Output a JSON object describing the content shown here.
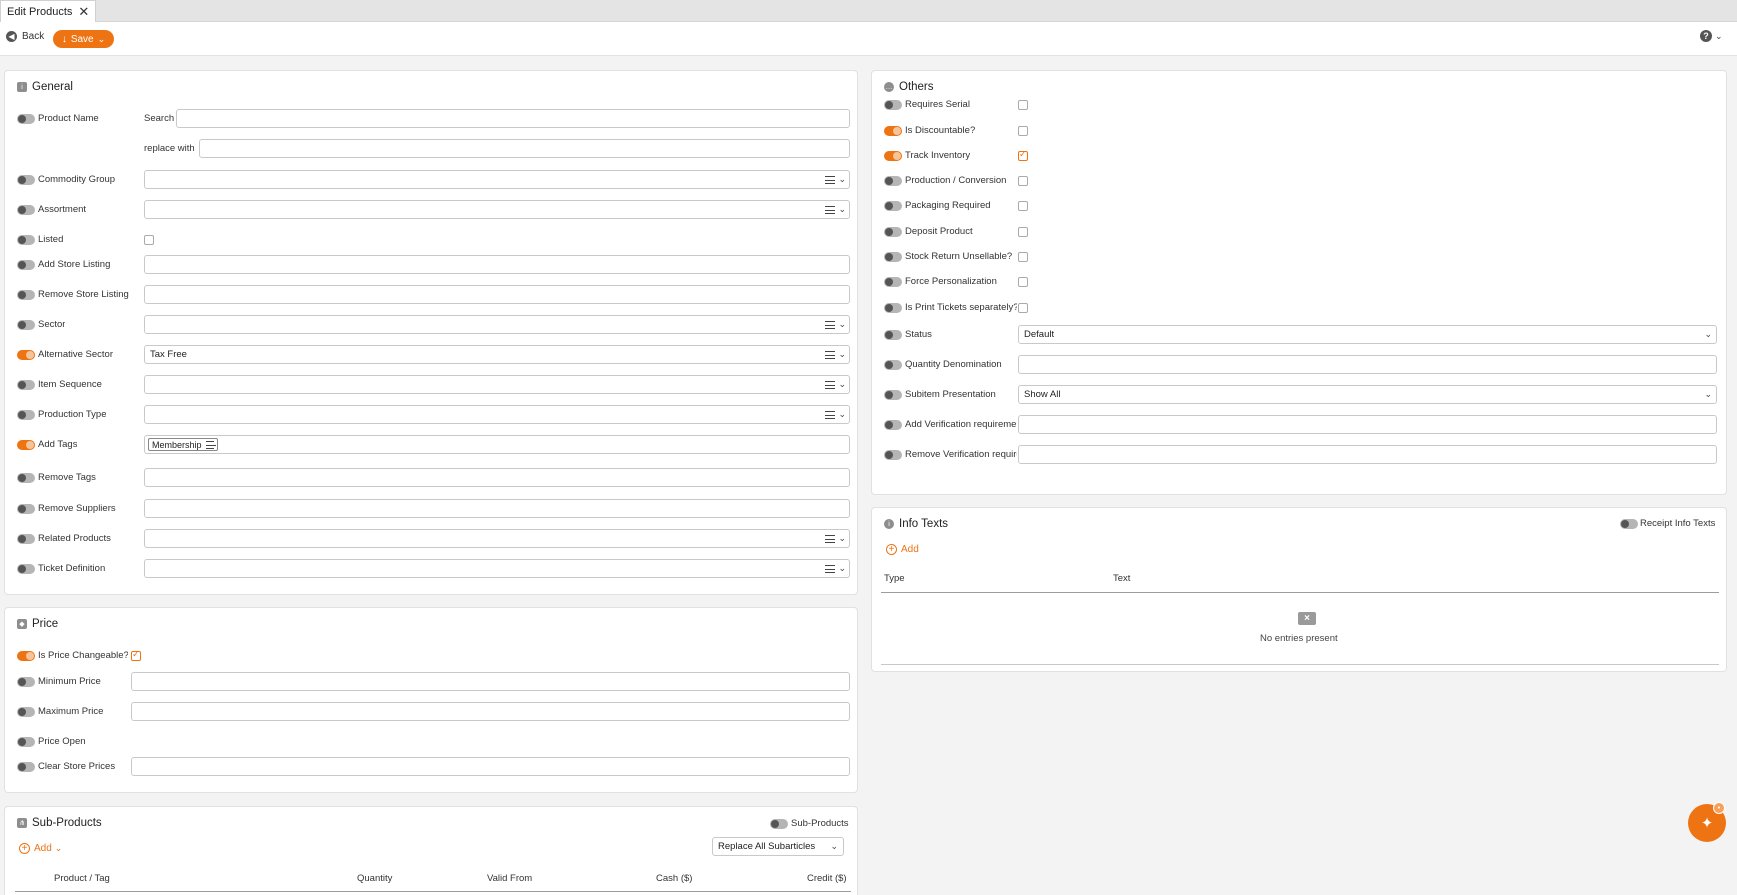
{
  "tab": {
    "title": "Edit Products"
  },
  "toolbar": {
    "back_label": "Back",
    "save_label": "Save"
  },
  "general": {
    "title": "General",
    "product_name": {
      "label": "Product Name",
      "search_label": "Search",
      "replace_label": "replace with",
      "search_value": "",
      "replace_value": ""
    },
    "rows": [
      {
        "label": "Commodity Group",
        "type": "select",
        "value": "",
        "on": false
      },
      {
        "label": "Assortment",
        "type": "select",
        "value": "",
        "on": false
      },
      {
        "label": "Listed",
        "type": "checkbox",
        "checked": false,
        "on": false
      },
      {
        "label": "Add Store Listing",
        "type": "input",
        "value": "",
        "on": false
      },
      {
        "label": "Remove Store Listing",
        "type": "input",
        "value": "",
        "on": false
      },
      {
        "label": "Sector",
        "type": "select",
        "value": "",
        "on": false
      },
      {
        "label": "Alternative Sector",
        "type": "select",
        "value": "Tax Free",
        "on": true
      },
      {
        "label": "Item Sequence",
        "type": "select",
        "value": "",
        "on": false
      },
      {
        "label": "Production Type",
        "type": "select",
        "value": "",
        "on": false
      },
      {
        "label": "Add Tags",
        "type": "tags",
        "value": "Membership",
        "on": true
      },
      {
        "label": "Remove Tags",
        "type": "input",
        "value": "",
        "on": false
      },
      {
        "label": "Remove Suppliers",
        "type": "input",
        "value": "",
        "on": false
      },
      {
        "label": "Related Products",
        "type": "select",
        "value": "",
        "on": false
      },
      {
        "label": "Ticket Definition",
        "type": "select",
        "value": "",
        "on": false
      }
    ]
  },
  "price": {
    "title": "Price",
    "rows": [
      {
        "label": "Is Price Changeable?",
        "type": "checkbox",
        "checked": true,
        "on": true
      },
      {
        "label": "Minimum Price",
        "type": "input",
        "value": "",
        "on": false
      },
      {
        "label": "Maximum Price",
        "type": "input",
        "value": "",
        "on": false
      },
      {
        "label": "Price Open",
        "type": "none",
        "on": false
      },
      {
        "label": "Clear Store Prices",
        "type": "input",
        "value": "",
        "on": false
      }
    ]
  },
  "subproducts": {
    "title": "Sub-Products",
    "toggle_label": "Sub-Products",
    "add_label": "Add",
    "replace_select": "Replace All Subarticles",
    "columns": [
      "Product / Tag",
      "Quantity",
      "Valid From",
      "Cash ($)",
      "Credit ($)"
    ]
  },
  "others": {
    "title": "Others",
    "rows": [
      {
        "label": "Requires Serial",
        "type": "checkbox",
        "checked": false,
        "on": false
      },
      {
        "label": "Is Discountable?",
        "type": "checkbox",
        "checked": false,
        "on": true
      },
      {
        "label": "Track Inventory",
        "type": "checkbox",
        "checked": true,
        "on": true
      },
      {
        "label": "Production / Conversion",
        "type": "checkbox",
        "checked": false,
        "on": false
      },
      {
        "label": "Packaging Required",
        "type": "checkbox",
        "checked": false,
        "on": false
      },
      {
        "label": "Deposit Product",
        "type": "checkbox",
        "checked": false,
        "on": false
      },
      {
        "label": "Stock Return Unsellable?",
        "type": "checkbox",
        "checked": false,
        "on": false
      },
      {
        "label": "Force Personalization",
        "type": "checkbox",
        "checked": false,
        "on": false
      },
      {
        "label": "Is Print Tickets separately?",
        "type": "checkbox",
        "checked": false,
        "on": false
      },
      {
        "label": "Status",
        "type": "dropdown",
        "value": "Default",
        "on": false
      },
      {
        "label": "Quantity Denomination",
        "type": "input",
        "value": "",
        "on": false
      },
      {
        "label": "Subitem Presentation",
        "type": "dropdown",
        "value": "Show All",
        "on": false
      },
      {
        "label": "Add Verification requirements",
        "type": "input",
        "value": "",
        "on": false
      },
      {
        "label": "Remove Verification requirements",
        "type": "input",
        "value": "",
        "on": false
      }
    ]
  },
  "info": {
    "title": "Info Texts",
    "toggle_label": "Receipt Info Texts",
    "add_label": "Add",
    "columns": [
      "Type",
      "Text"
    ],
    "empty_text": "No entries present"
  },
  "colors": {
    "accent": "#ee7313"
  }
}
